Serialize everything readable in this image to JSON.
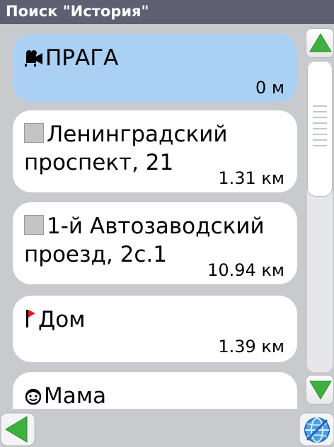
{
  "window": {
    "title": "Поиск \"История\""
  },
  "results": [
    {
      "icon": "camera-icon",
      "name_lines": [
        "ПРАГА"
      ],
      "distance": "0 м",
      "selected": true
    },
    {
      "icon": "gray-square-icon",
      "name_lines": [
        "Ленинградский",
        "проспект, 21"
      ],
      "distance": "1.31 км",
      "selected": false
    },
    {
      "icon": "gray-square-icon",
      "name_lines": [
        "1-й Автозаводский",
        "проезд, 2с.1"
      ],
      "distance": "10.94 км",
      "selected": false
    },
    {
      "icon": "red-flag-icon",
      "name_lines": [
        "Дом"
      ],
      "distance": "1.39 км",
      "selected": false
    },
    {
      "icon": "smiley-face-icon",
      "name_lines": [
        "Мама"
      ],
      "distance": "",
      "selected": false
    }
  ],
  "colors": {
    "titlebar": "#5e6072",
    "selected_card": "#aad0f3",
    "background": "#c9cacd",
    "arrow_green": "#3db13d"
  }
}
